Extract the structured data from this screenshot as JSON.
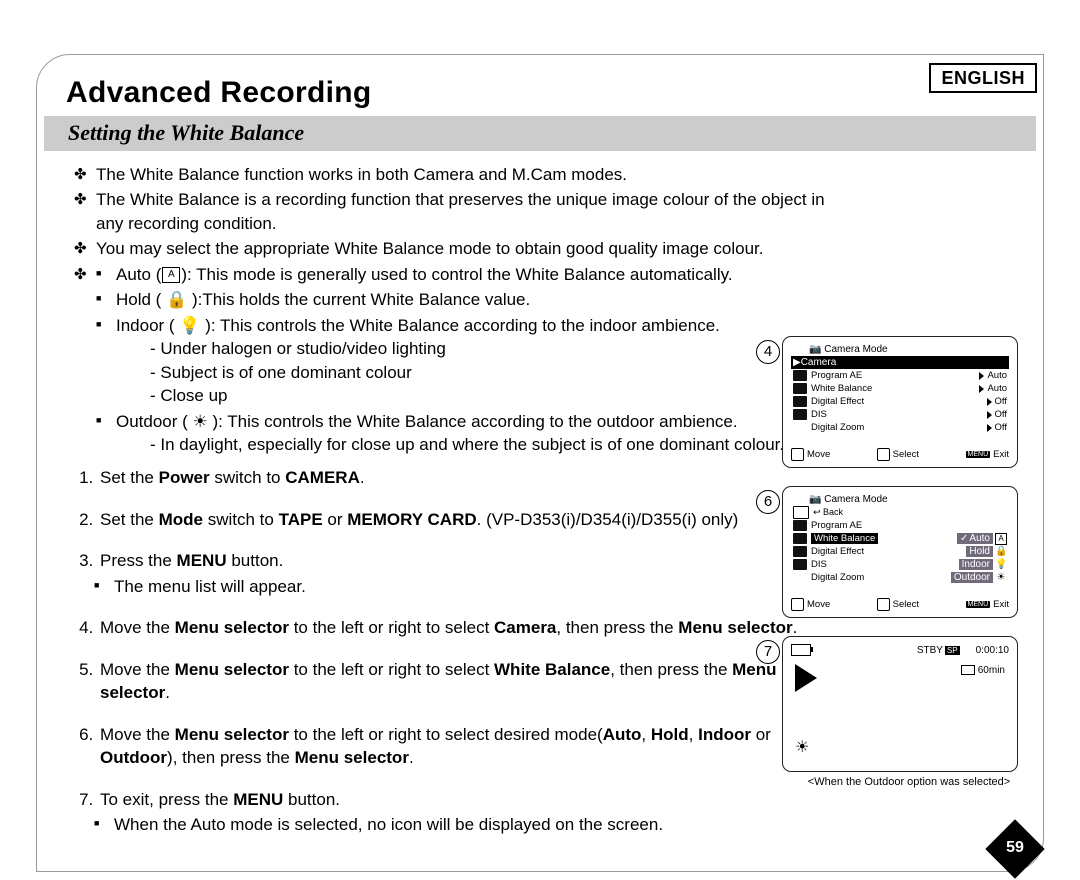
{
  "lang_label": "ENGLISH",
  "h1": "Advanced Recording",
  "subhead": "Setting the White Balance",
  "intro": [
    "The White Balance function works in both Camera and M.Cam modes.",
    "The White Balance is a recording function that preserves the unique image colour of the object in any recording condition.",
    "You may select the appropriate White Balance mode to obtain good quality image colour."
  ],
  "modes": {
    "auto": "Auto (",
    "auto_letter": "A",
    "auto_tail": "): This mode is generally used to control the White Balance automatically.",
    "hold": "Hold ( 🔒 ):This holds the current White Balance value.",
    "indoor": "Indoor ( 💡 ): This controls the White Balance according to the indoor ambience.",
    "indoor_sub": [
      "Under halogen or studio/video lighting",
      "Subject is of one dominant colour",
      "Close up"
    ],
    "outdoor": "Outdoor ( ☀ ): This controls the White Balance according to the outdoor ambience.",
    "outdoor_sub": [
      "In daylight, especially for close up and where the subject is of one dominant colour."
    ]
  },
  "steps": {
    "s1a": "Set the ",
    "s1b": "Power",
    "s1c": " switch to ",
    "s1d": "CAMERA",
    "s1e": ".",
    "s2a": "Set the ",
    "s2b": "Mode",
    "s2c": " switch to ",
    "s2d": "TAPE",
    "s2e": " or ",
    "s2f": "MEMORY CARD",
    "s2g": ". (VP-D353(i)/D354(i)/D355(i) only)",
    "s3a": "Press the ",
    "s3b": "MENU",
    "s3c": " button.",
    "s3sub": "The menu list will appear.",
    "s4a": "Move the ",
    "s4b": "Menu selector",
    "s4c": " to the left or right to select ",
    "s4d": "Camera",
    "s4e": ", then press the ",
    "s4f": "Menu selector",
    "s4g": ".",
    "s5a": "Move the ",
    "s5b": "Menu selector",
    "s5c": " to the left or right to select ",
    "s5d": "White Balance",
    "s5e": ", then press the ",
    "s5f": "Menu selector",
    "s5g": ".",
    "s6a": "Move the ",
    "s6b": "Menu selector",
    "s6c": " to the left or right to select desired mode(",
    "s6d": "Auto",
    "s6e": ", ",
    "s6f": "Hold",
    "s6g": ", ",
    "s6h": "Indoor",
    "s6i": " or ",
    "s6j": "Outdoor",
    "s6k": "), then press the ",
    "s6l": "Menu selector",
    "s6m": ".",
    "s7a": "To exit, press the ",
    "s7b": "MENU",
    "s7c": " button.",
    "s7sub": "When the Auto mode is selected, no icon will be displayed on the screen."
  },
  "screen4": {
    "num": "4",
    "title": "Camera Mode",
    "hl": "▶Camera",
    "rows": [
      {
        "label": "Program AE",
        "val": "Auto"
      },
      {
        "label": "White Balance",
        "val": "Auto"
      },
      {
        "label": "Digital Effect",
        "val": "Off"
      },
      {
        "label": "DIS",
        "val": "Off"
      },
      {
        "label": "Digital Zoom",
        "val": "Off"
      }
    ],
    "foot": {
      "move": "Move",
      "select": "Select",
      "exit": "Exit",
      "menu": "MENU"
    }
  },
  "screen6": {
    "num": "6",
    "title": "Camera Mode",
    "back": "Back",
    "rows_left": [
      "Program AE",
      "White Balance",
      "Digital Effect",
      "DIS",
      "Digital Zoom"
    ],
    "sel_index": 1,
    "opts": [
      {
        "label": "Auto",
        "icon": "A",
        "checked": true
      },
      {
        "label": "Hold",
        "icon": "🔒"
      },
      {
        "label": "Indoor",
        "icon": "💡"
      },
      {
        "label": "Outdoor",
        "icon": "☀"
      }
    ],
    "foot": {
      "move": "Move",
      "select": "Select",
      "exit": "Exit",
      "menu": "MENU"
    }
  },
  "screen7": {
    "num": "7",
    "stby": "STBY",
    "sp": "SP",
    "time": "0:00:10",
    "remain": "60min",
    "caption": "<When the Outdoor option was selected>"
  },
  "page_number": "59"
}
